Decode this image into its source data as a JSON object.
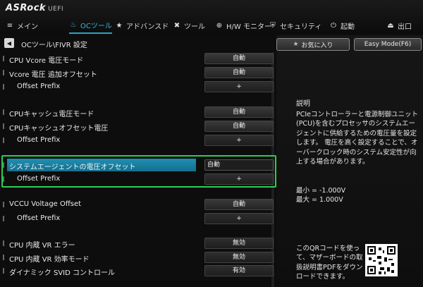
{
  "brand": {
    "logo": "ASRock",
    "suffix": "UEFI"
  },
  "tabs": [
    {
      "label": "メイン",
      "icon": "list-icon",
      "glyph": "≡"
    },
    {
      "label": "OCツール",
      "icon": "flame-icon",
      "glyph": "♨",
      "active": true
    },
    {
      "label": "アドバンスド",
      "icon": "star-icon",
      "glyph": "★"
    },
    {
      "label": "ツール",
      "icon": "wrench-icon",
      "glyph": "✖"
    },
    {
      "label": "H/W モニター",
      "icon": "monitor-icon",
      "glyph": "⊕"
    },
    {
      "label": "セキュリティ",
      "icon": "shield-icon",
      "glyph": "⛨"
    },
    {
      "label": "起動",
      "icon": "power-icon",
      "glyph": "⏻"
    },
    {
      "label": "出口",
      "icon": "exit-icon",
      "glyph": "⏏"
    }
  ],
  "breadcrumb": "OCツール\\FIVR 設定",
  "rows": [
    {
      "label": "CPU Vcore 電圧モード",
      "value": "自動"
    },
    {
      "label": "Vcore 電圧 追加オフセット",
      "value": "自動"
    },
    {
      "label": "Offset Prefix",
      "value": "+",
      "sub": true
    },
    {
      "label": "CPUキャッシュ電圧モード",
      "value": "自動"
    },
    {
      "label": "CPUキャッシュオフセット電圧",
      "value": "自動"
    },
    {
      "label": "Offset Prefix",
      "value": "+",
      "sub": true
    },
    {
      "label": "システムエージェントの電圧オフセット",
      "value": "自動",
      "selected": true
    },
    {
      "label": "Offset Prefix",
      "value": "+",
      "sub": true
    },
    {
      "label": "VCCU Voltage Offset",
      "value": "自動"
    },
    {
      "label": "Offset Prefix",
      "value": "+",
      "sub": true
    },
    {
      "label": "CPU 内蔵 VR エラー",
      "value": "無効"
    },
    {
      "label": "CPU 内蔵 VR 効率モード",
      "value": "無効"
    },
    {
      "label": "ダイナミック SVID コントロール",
      "value": "有効"
    }
  ],
  "side": {
    "favorites_label": "お気に入り",
    "easy_mode_label": "Easy Mode(F6)",
    "desc_title": "説明",
    "desc_body": "PCIeコントローラーと電源制御ユニット(PCU)を含むプロセッサのシステムエージェントに供給するための電圧量を設定します。 電圧を高く設定することで、オーバークロック時のシステム安定性が向上する場合があります。",
    "min": "最小 = -1.000V",
    "max": "最大 = 1.000V",
    "qr_text": "このQRコードを使って、マザーボードの取扱説明書PDFをダウンロードできます。"
  },
  "colors": {
    "accent": "#2aa3c8",
    "highlight": "#29d04f"
  }
}
